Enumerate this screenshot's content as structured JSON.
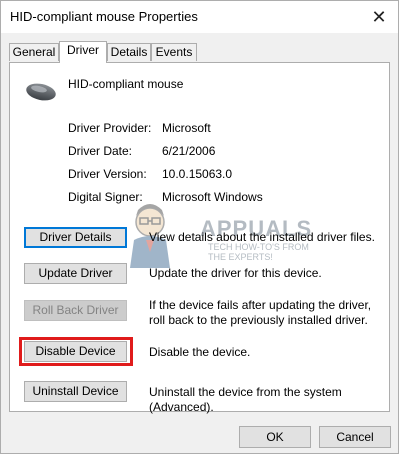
{
  "window": {
    "title": "HID-compliant mouse Properties",
    "close_glyph": "✕"
  },
  "tabs": [
    {
      "label": "General",
      "active": false
    },
    {
      "label": "Driver",
      "active": true
    },
    {
      "label": "Details",
      "active": false
    },
    {
      "label": "Events",
      "active": false
    }
  ],
  "device": {
    "name": "HID-compliant mouse",
    "icon": "mouse-icon"
  },
  "info": [
    {
      "label": "Driver Provider:",
      "value": "Microsoft"
    },
    {
      "label": "Driver Date:",
      "value": "6/21/2006"
    },
    {
      "label": "Driver Version:",
      "value": "10.0.15063.0"
    },
    {
      "label": "Digital Signer:",
      "value": "Microsoft Windows"
    }
  ],
  "actions": [
    {
      "label": "Driver Details",
      "description": "View details about the installed driver files.",
      "state": "focused"
    },
    {
      "label": "Update Driver",
      "description": "Update the driver for this device.",
      "state": "normal"
    },
    {
      "label": "Roll Back Driver",
      "description": "If the device fails after updating the driver, roll back to the previously installed driver.",
      "state": "disabled"
    },
    {
      "label": "Disable Device",
      "description": "Disable the device.",
      "state": "highlighted"
    },
    {
      "label": "Uninstall Device",
      "description": "Uninstall the device from the system (Advanced).",
      "state": "normal"
    }
  ],
  "watermark": {
    "brand": "APPUALS",
    "tagline": [
      "TECH HOW-TO'S FROM",
      "THE EXPERTS!"
    ]
  },
  "footer": {
    "ok_label": "OK",
    "cancel_label": "Cancel"
  },
  "colors": {
    "highlight": "#e01b1b",
    "focus": "#0078d7"
  }
}
